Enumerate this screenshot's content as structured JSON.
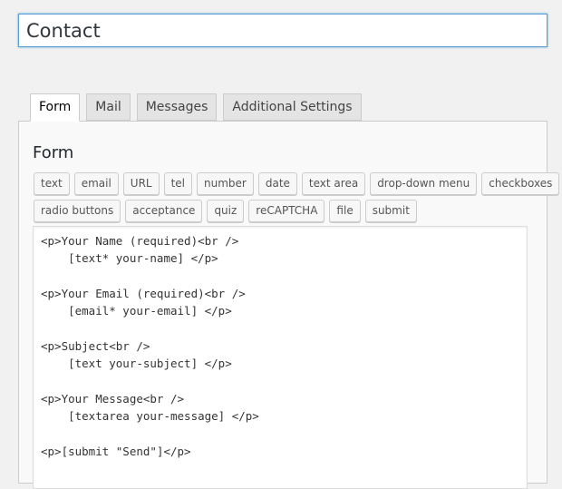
{
  "title_input": {
    "value": "Contact"
  },
  "tabs": [
    {
      "label": "Form",
      "active": true
    },
    {
      "label": "Mail",
      "active": false
    },
    {
      "label": "Messages",
      "active": false
    },
    {
      "label": "Additional Settings",
      "active": false
    }
  ],
  "panel": {
    "heading": "Form",
    "tag_buttons_row1": [
      "text",
      "email",
      "URL",
      "tel",
      "number",
      "date",
      "text area",
      "drop-down menu",
      "checkboxes"
    ],
    "tag_buttons_row2": [
      "radio buttons",
      "acceptance",
      "quiz",
      "reCAPTCHA",
      "file",
      "submit"
    ],
    "code_lines": [
      "<p>Your Name (required)<br />",
      "    [text* your-name] </p>",
      "",
      "<p>Your Email (required)<br />",
      "    [email* your-email] </p>",
      "",
      "<p>Subject<br />",
      "    [text your-subject] </p>",
      "",
      "<p>Your Message<br />",
      "    [textarea your-message] </p>",
      "",
      "<p>[submit \"Send\"]</p>"
    ]
  },
  "colors": {
    "page_background": "#f1f1f1",
    "focus_border": "#5b9dd9",
    "panel_background": "#f9f9f9"
  }
}
